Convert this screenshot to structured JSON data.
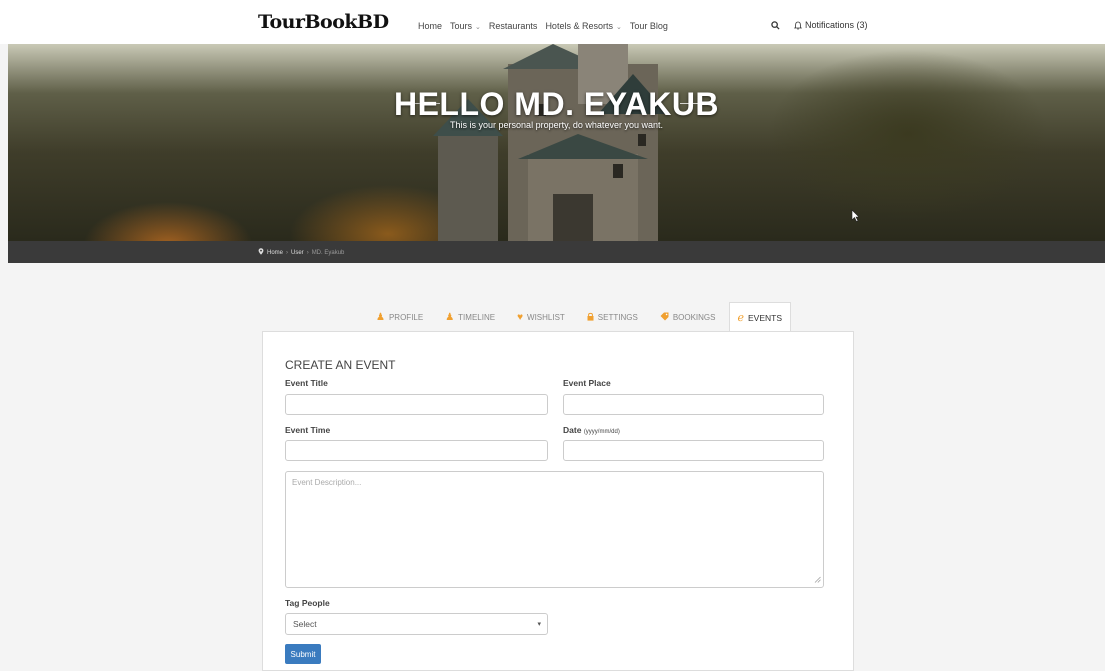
{
  "brand": {
    "logo": "TourBookBD"
  },
  "nav": {
    "items": [
      {
        "label": "Home",
        "has_caret": false
      },
      {
        "label": "Tours",
        "has_caret": true
      },
      {
        "label": "Restaurants",
        "has_caret": false
      },
      {
        "label": "Hotels & Resorts",
        "has_caret": true
      },
      {
        "label": "Tour Blog",
        "has_caret": false
      }
    ],
    "notifications_label": "Notifications (3)"
  },
  "hero": {
    "title": "HELLO MD. EYAKUB",
    "subtitle": "This is your personal property, do whatever you want."
  },
  "breadcrumb": {
    "home": "Home",
    "section": "User",
    "current": "MD. Eyakub"
  },
  "tabs": [
    {
      "label": "PROFILE",
      "icon": "user-icon",
      "active": false
    },
    {
      "label": "TIMELINE",
      "icon": "user-icon",
      "active": false
    },
    {
      "label": "WISHLIST",
      "icon": "heart-icon",
      "active": false
    },
    {
      "label": "SETTINGS",
      "icon": "lock-icon",
      "active": false
    },
    {
      "label": "BOOKINGS",
      "icon": "tag-icon",
      "active": false
    },
    {
      "label": "EVENTS",
      "icon": "event-icon",
      "active": true
    }
  ],
  "form": {
    "heading": "CREATE AN EVENT",
    "event_title_label": "Event Title",
    "event_place_label": "Event Place",
    "event_time_label": "Event Time",
    "date_label": "Date",
    "date_hint": "(yyyy/mm/dd)",
    "description_placeholder": "Event Description...",
    "tag_people_label": "Tag People",
    "tag_people_selected": "Select",
    "submit_label": "Submit"
  },
  "colors": {
    "accent": "#3a7bbf",
    "tab_icon": "#f0a030",
    "crumb_bar": "#3a3a3a"
  }
}
